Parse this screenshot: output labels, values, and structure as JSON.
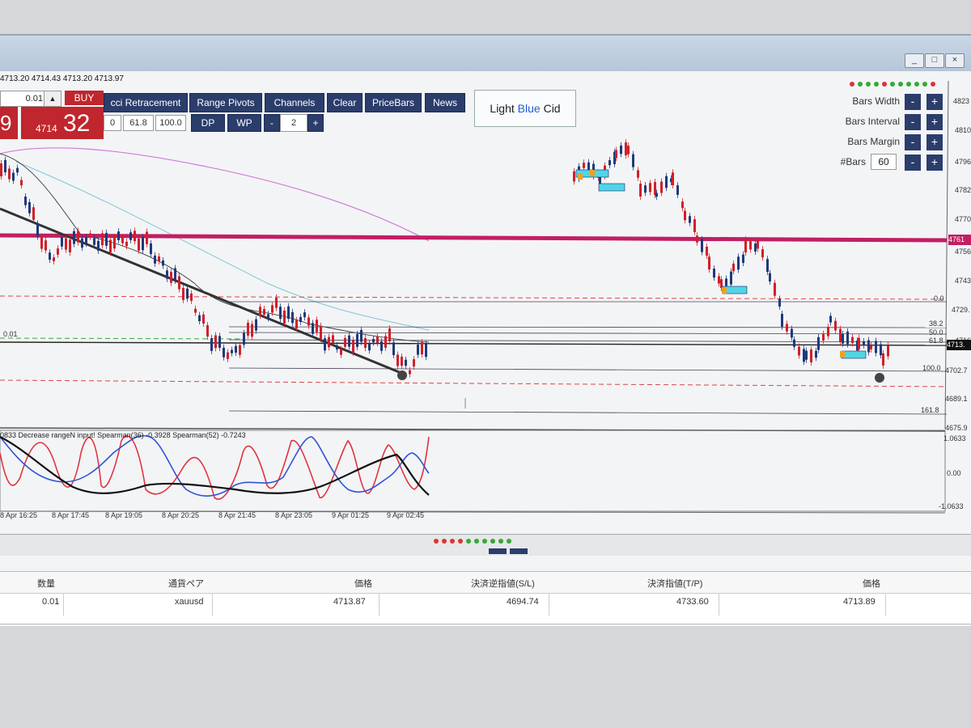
{
  "ohlc": "4713.20 4714.43 4713.20 4713.97",
  "trade": {
    "lot": "0.01",
    "buy_label": "BUY",
    "price_prefix": "4714",
    "price_big": "32",
    "sell_partial": "9"
  },
  "toolbar": {
    "fib_label": "cci Retracement",
    "range_pivots": "Range Pivots",
    "channels": "Channels",
    "clear": "Clear",
    "pricebars": "PriceBars",
    "news": "News",
    "fib_vals": [
      "0",
      "61.8",
      "100.0"
    ],
    "dp": "DP",
    "wp": "WP",
    "minus": "-",
    "count": "2",
    "plus": "+"
  },
  "legend": {
    "w1": "Light",
    "w2": "Blue",
    "w3": "Cid",
    "blue_color": "#1f5fd6"
  },
  "controls": {
    "bars_width": "Bars Width",
    "bars_interval": "Bars Interval",
    "bars_margin": "Bars Margin",
    "nbars": "#Bars",
    "nbars_value": "60",
    "minus": "-",
    "plus": "+"
  },
  "price_axis": [
    "4823",
    "4810",
    "4796",
    "4782",
    "4770",
    "4756",
    "4743",
    "4729.",
    "4716",
    "4702.7",
    "4689.1",
    "4675.9"
  ],
  "current_price": "4713.",
  "red_line_price": "4761",
  "fib_levels": [
    "0.0",
    "38.2",
    "50.0",
    "61.8",
    "100.0",
    "161.8"
  ],
  "left_level": "0.01",
  "osc": {
    "legend": "0833 Decrease rangeN input! Spearman(36) -0.3928 Spearman(52) -0.7243",
    "axis": [
      "1.0633",
      "0.00",
      "-1.0633"
    ]
  },
  "time_axis": [
    "8 Apr 16:25",
    "8 Apr 17:45",
    "8 Apr 19:05",
    "8 Apr 20:25",
    "8 Apr 21:45",
    "8 Apr 23:05",
    "9 Apr 01:25",
    "9 Apr 02:45"
  ],
  "window_buttons": [
    "_",
    "□",
    "×"
  ],
  "table": {
    "headers": [
      "数量",
      "通貨ペア",
      "価格",
      "決済逆指値(S/L)",
      "決済指値(T/P)",
      "価格"
    ],
    "row": [
      "0.01",
      "xauusd",
      "4713.87",
      "4694.74",
      "4733.60",
      "4713.89"
    ]
  },
  "colors": {
    "accent_navy": "#2b3d6b",
    "buy_red": "#c0262d",
    "bull": "#1f3a7a",
    "bear": "#d0202a",
    "level_magenta": "#c21e63"
  }
}
